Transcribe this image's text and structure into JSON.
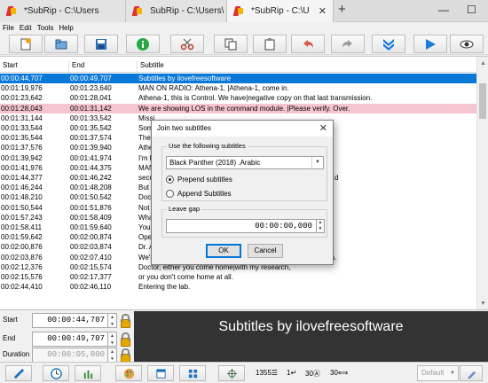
{
  "tabs": [
    {
      "title": "*SubRip - C:\\Users"
    },
    {
      "title": "SubRip - C:\\Users\\"
    },
    {
      "title": "*SubRip - C:\\U"
    }
  ],
  "tab_close_glyph": "✕",
  "newtab_glyph": "+",
  "window_buttons": {
    "minimize": "—",
    "maximize": "☐"
  },
  "menu": [
    "File",
    "Edit",
    "Tools",
    "Help"
  ],
  "toolbar_icons": [
    "new-file-icon",
    "open-file-icon",
    "save-icon",
    "info-icon",
    "cut-icon",
    "copy-icon",
    "paste-icon",
    "undo-icon",
    "redo-icon",
    "double-chevron-down-icon",
    "play-icon",
    "eye-icon"
  ],
  "grid": {
    "headers": {
      "start": "Start",
      "end": "End",
      "subtitle": "Subtitle"
    },
    "rows": [
      {
        "start": "00:00:44,707",
        "end": "00:00:49,707",
        "text": "Subtitles by ilovefreesoftware",
        "state": "selected"
      },
      {
        "start": "00:01:19,976",
        "end": "00:01:23,640",
        "text": "MAN ON RADIO: Athena-1. |Athena-1, come in.",
        "state": ""
      },
      {
        "start": "00:01:23,642",
        "end": "00:01:28,041",
        "text": "Athena-1, this is Control. We have|negative copy on that last transmission.",
        "state": ""
      },
      {
        "start": "00:01:28,043",
        "end": "00:01:31,142",
        "text": "We are showing LOS in the command module. |Please verify. Over.",
        "state": "error"
      },
      {
        "start": "00:01:31,144",
        "end": "00:01:33,542",
        "text": "Missi",
        "state": ""
      },
      {
        "start": "00:01:33,544",
        "end": "00:01:35,542",
        "text": "Some",
        "state": ""
      },
      {
        "start": "00:01:35,544",
        "end": "00:01:37,574",
        "text": "The c",
        "state": ""
      },
      {
        "start": "00:01:37,576",
        "end": "00:01:39,940",
        "text": "Athe",
        "state": ""
      },
      {
        "start": "00:01:39,942",
        "end": "00:01:41,974",
        "text": "I'm h",
        "state": ""
      },
      {
        "start": "00:01:41,976",
        "end": "00:01:44,375",
        "text": "MAN",
        "state": ""
      },
      {
        "start": "00:01:44,377",
        "end": "00:01:46,242",
        "text": "secu",
        "state": ""
      },
      {
        "start": "00:01:46,244",
        "end": "00:01:48,208",
        "text": "But t",
        "state": ""
      },
      {
        "start": "00:01:48,210",
        "end": "00:01:50,542",
        "text": "Doct",
        "state": ""
      },
      {
        "start": "00:01:50,544",
        "end": "00:01:51,876",
        "text": "Not a",
        "state": ""
      },
      {
        "start": "00:01:57,243",
        "end": "00:01:58,409",
        "text": "What",
        "state": ""
      },
      {
        "start": "00:01:58,411",
        "end": "00:01:59,640",
        "text": "You h",
        "state": ""
      },
      {
        "start": "00:01:59,642",
        "end": "00:02:00,874",
        "text": "Oper",
        "state": ""
      },
      {
        "start": "00:02:00,876",
        "end": "00:02:03,874",
        "text": "Dr. A",
        "state": ""
      },
      {
        "start": "00:02:03,876",
        "end": "00:02:07,410",
        "text": "We'll unlock the escape capsule|when you secure the samples.",
        "state": ""
      },
      {
        "start": "00:02:12,376",
        "end": "00:02:15,574",
        "text": "Doctor, either you come home|with my research,",
        "state": ""
      },
      {
        "start": "00:02:15,576",
        "end": "00:02:17,377",
        "text": "or you don't come home at all.",
        "state": ""
      },
      {
        "start": "00:02:44,410",
        "end": "00:02:46,110",
        "text": "Entering the lab.",
        "state": ""
      }
    ],
    "row10_tail": "d"
  },
  "editor": {
    "start_label": "Start",
    "start_value": "00:00:44,707",
    "end_label": "End",
    "end_value": "00:00:49,707",
    "duration_label": "Duration",
    "duration_value": "00:00:05,000",
    "preview_text": "Subtitles by ilovefreesoftware"
  },
  "bottom": {
    "icons": [
      "ruler-icon",
      "clock-icon",
      "waveform-icon",
      "palette-icon",
      "window-icon",
      "grid-icon",
      "crosshair-icon"
    ],
    "count": "1355",
    "line": "1",
    "cps": "30",
    "width": "30",
    "style_select": "Default",
    "colors": {
      "selected": "#0a78d7",
      "error_row": "#f5c6cf",
      "preview_bg": "#333333"
    }
  },
  "dialog": {
    "title": "Join two subtitles",
    "close": "✕",
    "use_label": "Use the following subtitles",
    "selected_file": "Black Panther (2018) .Arabic",
    "options": [
      {
        "label": "Prepend subtitles",
        "checked": true
      },
      {
        "label": "Append Subtitles",
        "checked": false
      }
    ],
    "gap_label": "Leave gap",
    "gap_value": "00:00:00,000",
    "ok": "OK",
    "cancel": "Cancel"
  }
}
